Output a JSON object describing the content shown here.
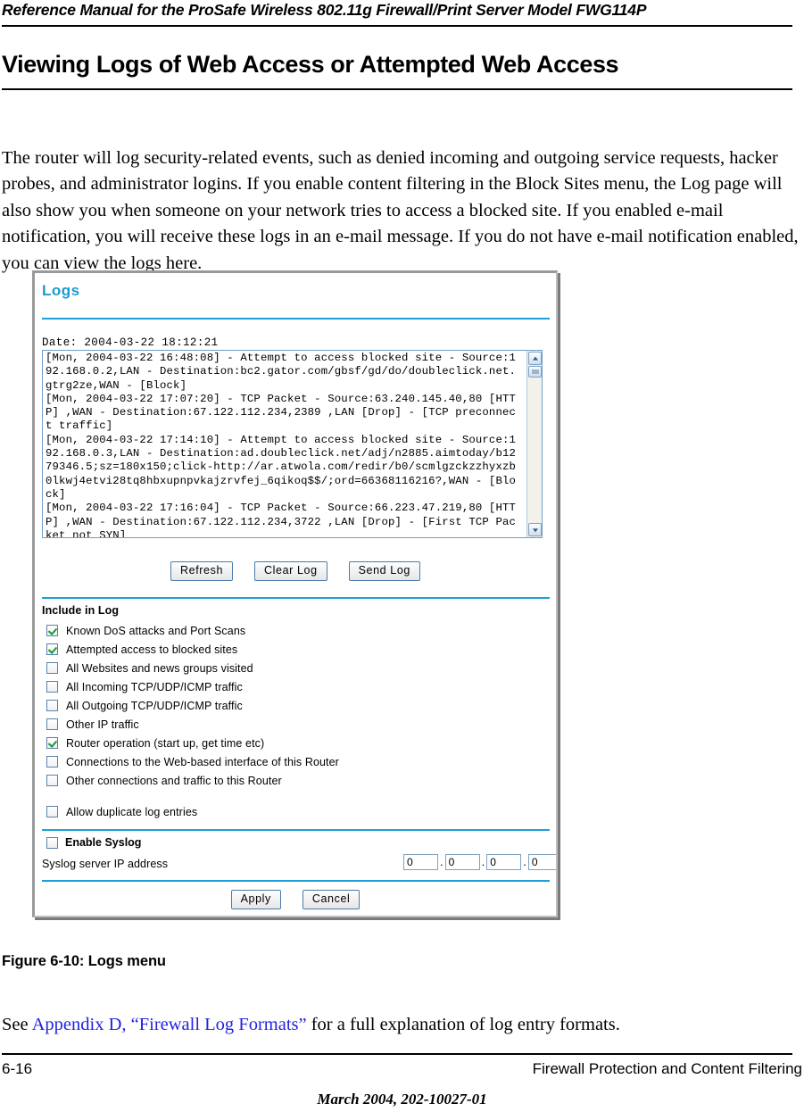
{
  "running_head": "Reference Manual for the ProSafe Wireless 802.11g  Firewall/Print Server Model FWG114P",
  "page_title": "Viewing Logs of Web Access or Attempted Web Access",
  "intro_paragraph": "The router will log security-related events, such as denied incoming and outgoing service requests, hacker probes, and administrator logins. If you enable content filtering in the Block Sites menu, the Log page will also show you when someone on your network tries to access a blocked site. If you enabled e-mail notification, you will receive these logs in an e-mail message. If you do not have e-mail notification enabled, you can view the logs here.",
  "figure": {
    "title": "Logs",
    "date_line": "Date: 2004-03-22 18:12:21",
    "log_text": "[Mon, 2004-03-22 16:48:08] - Attempt to access blocked site - Source:192.168.0.2,LAN - Destination:bc2.gator.com/gbsf/gd/do/doubleclick.net.gtrg2ze,WAN - [Block]\n[Mon, 2004-03-22 17:07:20] - TCP Packet - Source:63.240.145.40,80 [HTTP] ,WAN - Destination:67.122.112.234,2389 ,LAN [Drop] - [TCP preconnect traffic]\n[Mon, 2004-03-22 17:14:10] - Attempt to access blocked site - Source:192.168.0.3,LAN - Destination:ad.doubleclick.net/adj/n2885.aimtoday/b1279346.5;sz=180x150;click-http://ar.atwola.com/redir/b0/scmlgzckzzhyxzb0lkwj4etvi28tq8hbxupnpvkajzrvfej_6qikoq$$/;ord=66368116216?,WAN - [Block]\n[Mon, 2004-03-22 17:16:04] - TCP Packet - Source:66.223.47.219,80 [HTTP] ,WAN - Destination:67.122.112.234,3722 ,LAN [Drop] - [First TCP Packet not SYN]",
    "log_buttons": [
      {
        "label": "Refresh"
      },
      {
        "label": "Clear Log"
      },
      {
        "label": "Send Log"
      }
    ],
    "include_in_log_heading": "Include in Log",
    "include_options": [
      {
        "label": "Known DoS attacks and Port Scans",
        "checked": true,
        "spaced": false
      },
      {
        "label": "Attempted access to blocked sites",
        "checked": true,
        "spaced": false
      },
      {
        "label": "All Websites and news groups visited",
        "checked": false,
        "spaced": false
      },
      {
        "label": "All Incoming TCP/UDP/ICMP traffic",
        "checked": false,
        "spaced": false
      },
      {
        "label": "All Outgoing TCP/UDP/ICMP traffic",
        "checked": false,
        "spaced": false
      },
      {
        "label": "Other IP traffic",
        "checked": false,
        "spaced": false
      },
      {
        "label": "Router operation (start up, get time etc)",
        "checked": true,
        "spaced": false
      },
      {
        "label": "Connections to the Web-based interface of this Router",
        "checked": false,
        "spaced": false
      },
      {
        "label": "Other connections and traffic to this Router",
        "checked": false,
        "spaced": false
      },
      {
        "label": "Allow duplicate log entries",
        "checked": false,
        "spaced": true
      }
    ],
    "syslog": {
      "enable_label": "Enable Syslog",
      "enable_checked": false,
      "ip_label": "Syslog server IP address",
      "ip_octets": [
        "0",
        "0",
        "0",
        "0"
      ],
      "octet_separator": "."
    },
    "form_buttons": [
      {
        "label": "Apply"
      },
      {
        "label": "Cancel"
      }
    ]
  },
  "figure_caption": "Figure 6-10:  Logs menu",
  "see_also": {
    "prefix": "See ",
    "link": "Appendix D, “Firewall Log Formats”",
    "suffix": " for a full explanation of log entry formats."
  },
  "footer": {
    "page_number": "6-16",
    "chapter": "Firewall Protection and Content Filtering",
    "date_code": "March 2004, 202-10027-01"
  }
}
